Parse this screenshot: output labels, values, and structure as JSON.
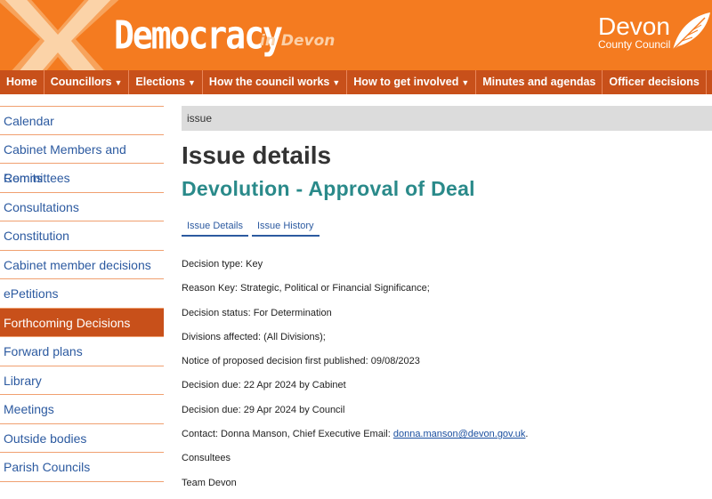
{
  "brand": {
    "title": "Democracy",
    "subtitle": "in Devon",
    "council_name": "Devon",
    "council_sub": "County Council"
  },
  "colors": {
    "orange": "#f47b20",
    "dark_orange": "#c8501a",
    "teal": "#2a8a8a",
    "link": "#2c5aa0"
  },
  "nav": [
    {
      "label": "Home",
      "dropdown": false
    },
    {
      "label": "Councillors",
      "dropdown": true
    },
    {
      "label": "Elections",
      "dropdown": true
    },
    {
      "label": "How the council works",
      "dropdown": true
    },
    {
      "label": "How to get involved",
      "dropdown": true
    },
    {
      "label": "Minutes and agendas",
      "dropdown": false
    },
    {
      "label": "Officer decisions",
      "dropdown": false
    }
  ],
  "sidebar": [
    {
      "label": "Calendar"
    },
    {
      "label": "Cabinet Members and Remits"
    },
    {
      "label": "Committees"
    },
    {
      "label": "Consultations"
    },
    {
      "label": "Constitution"
    },
    {
      "label": "Cabinet member decisions"
    },
    {
      "label": "ePetitions"
    },
    {
      "label": "Forthcoming Decisions",
      "active": true
    },
    {
      "label": "Forward plans"
    },
    {
      "label": "Library"
    },
    {
      "label": "Meetings"
    },
    {
      "label": "Outside bodies"
    },
    {
      "label": "Parish Councils"
    }
  ],
  "main": {
    "breadcrumb": "issue",
    "heading": "Issue details",
    "issue_title": "Devolution - Approval of Deal",
    "tabs": [
      {
        "label": "Issue Details"
      },
      {
        "label": "Issue History"
      }
    ],
    "details": [
      "Decision type: Key",
      "Reason Key: Strategic, Political or Financial Significance;",
      "Decision status: For Determination",
      "Divisions affected: (All Divisions);",
      "Notice of proposed decision first published: 09/08/2023",
      "Decision due: 22 Apr 2024 by Cabinet",
      "Decision due: 29 Apr 2024 by Council"
    ],
    "contact": {
      "prefix": "Contact: Donna Manson, Chief Executive Email: ",
      "email": "donna.manson@devon.gov.uk",
      "suffix": "."
    },
    "consultees_label": "Consultees",
    "consultees_value": "Team Devon"
  }
}
